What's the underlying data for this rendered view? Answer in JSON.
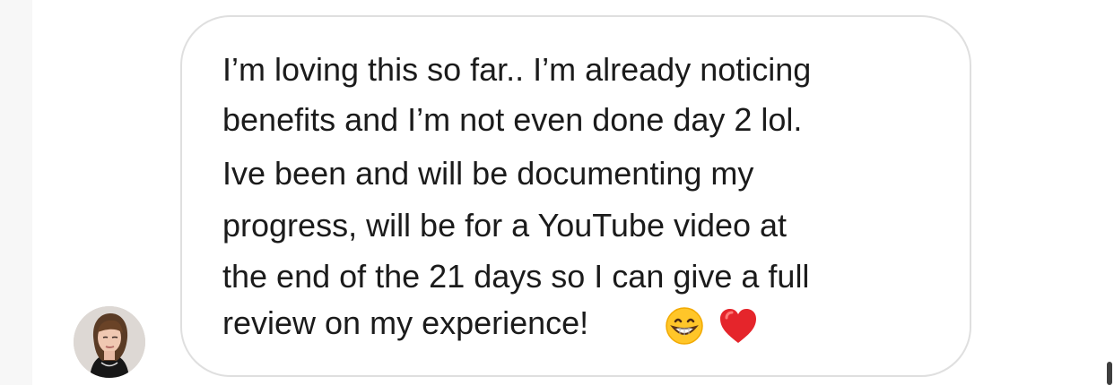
{
  "message": {
    "lines": [
      "I’m loving this so far.. I’m already noticing",
      "benefits and I’m not even done day 2 lol.",
      "Ive been and will be documenting my",
      "progress, will be for a YouTube video at",
      "the end of the 21 days so I can give a full",
      "review on my experience!"
    ],
    "emojis": [
      "grinning-face-icon",
      "red-heart-icon"
    ]
  },
  "colors": {
    "text": "#1b1b1b",
    "bubble_border": "#dfdfdf",
    "background": "#ffffff",
    "side_margin": "#f7f7f7",
    "heart": "#e5252b",
    "emoji_yellow": "#ffc629"
  }
}
